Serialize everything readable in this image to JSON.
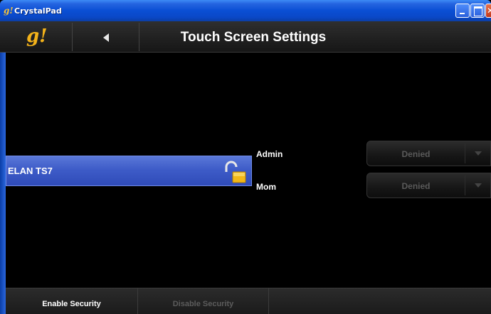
{
  "window": {
    "title": "CrystalPad",
    "logo_glyph": "g!"
  },
  "header": {
    "logo": "g!",
    "title": "Touch Screen Settings",
    "back_icon": "back-arrow-icon"
  },
  "devices": [
    {
      "name": "ELAN TS7",
      "lock_state": "unlocked",
      "selected": true
    }
  ],
  "permissions": [
    {
      "user": "Admin",
      "value": "Denied"
    },
    {
      "user": "Mom",
      "value": "Denied"
    }
  ],
  "toolbar": {
    "enable_label": "Enable Security",
    "disable_label": "Disable Security"
  },
  "colors": {
    "accent_blue": "#3e5cc8",
    "logo_gold": "#f3b21a",
    "lock_gold": "#f2b818"
  }
}
